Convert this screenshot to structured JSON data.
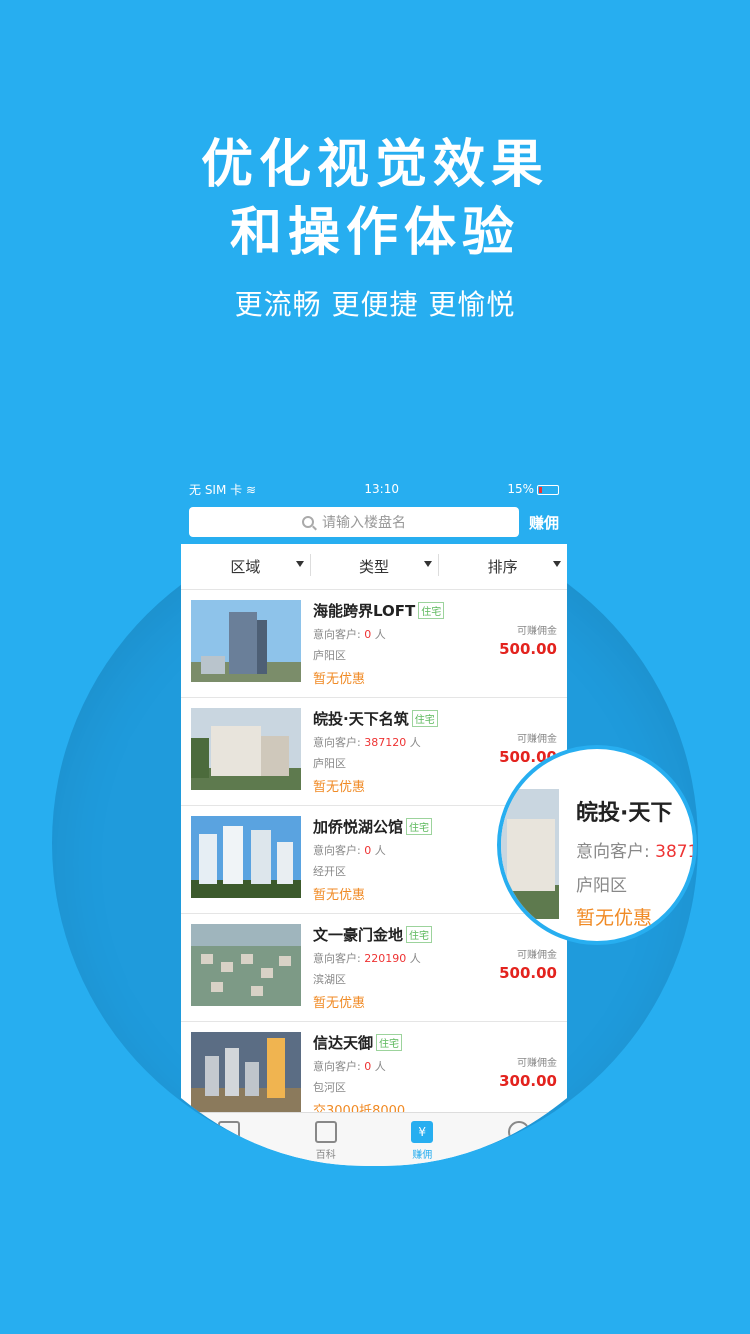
{
  "headline": {
    "line1": "优化视觉效果",
    "line2": "和操作体验",
    "subtitle": "更流畅 更便捷 更愉悦"
  },
  "status": {
    "carrier": "无 SIM 卡",
    "time": "13:10",
    "battery": "15%"
  },
  "search": {
    "placeholder": "请输入楼盘名",
    "earn_button": "赚佣"
  },
  "filters": [
    {
      "label": "区域"
    },
    {
      "label": "类型"
    },
    {
      "label": "排序"
    }
  ],
  "listing_labels": {
    "intent_prefix": "意向客户:",
    "person_unit": "人",
    "commission_label": "可赚佣金"
  },
  "listings": [
    {
      "name": "海能跨界LOFT",
      "tag": "住宅",
      "intent": "0",
      "district": "庐阳区",
      "promo": "暂无优惠",
      "commission": "500.00"
    },
    {
      "name": "皖投·天下名筑",
      "tag": "住宅",
      "intent": "387120",
      "district": "庐阳区",
      "promo": "暂无优惠",
      "commission": "500.00"
    },
    {
      "name": "加侨悦湖公馆",
      "tag": "住宅",
      "intent": "0",
      "district": "经开区",
      "promo": "暂无优惠",
      "commission": ""
    },
    {
      "name": "文一豪门金地",
      "tag": "住宅",
      "intent": "220190",
      "district": "滨湖区",
      "promo": "暂无优惠",
      "commission": "500.00"
    },
    {
      "name": "信达天御",
      "tag": "住宅",
      "intent": "0",
      "district": "包河区",
      "promo": "交3000抵8000",
      "commission": "300.00"
    }
  ],
  "tabbar": [
    {
      "label": ""
    },
    {
      "label": "百科"
    },
    {
      "label": "赚佣"
    },
    {
      "label": ""
    }
  ],
  "zoom": {
    "name": "皖投·天下",
    "intent_prefix": "意向客户:",
    "intent": "3871",
    "district": "庐阳区",
    "promo": "暂无优惠"
  }
}
